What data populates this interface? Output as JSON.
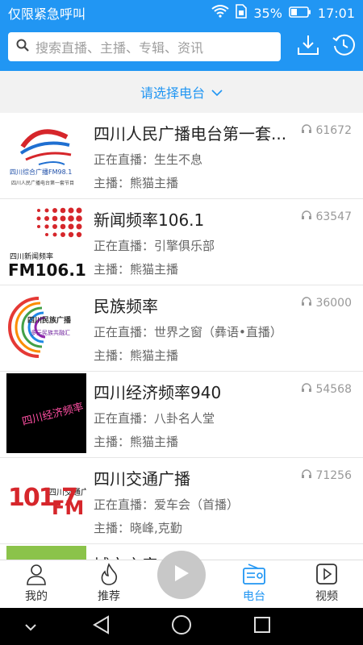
{
  "status_bar": {
    "carrier": "仅限紧急呼叫",
    "battery": "35%",
    "time": "17:01"
  },
  "search": {
    "placeholder": "搜索直播、主播、专辑、资讯"
  },
  "selector": {
    "label": "请选择电台"
  },
  "stations": [
    {
      "name": "四川人民广播电台第一套...",
      "live": "正在直播：生生不息",
      "host": "主播：熊猫主播",
      "listeners": "61672"
    },
    {
      "name": "新闻频率106.1",
      "live": "正在直播：引擎俱乐部",
      "host": "主播：熊猫主播",
      "listeners": "63547"
    },
    {
      "name": "民族频率",
      "live": "正在直播：世界之窗（彝语•直播）",
      "host": "主播：熊猫主播",
      "listeners": "36000"
    },
    {
      "name": "四川经济频率940",
      "live": "正在直播：八卦名人堂",
      "host": "主播：熊猫主播",
      "listeners": "54568"
    },
    {
      "name": "四川交通广播",
      "live": "正在直播：爱车会（首播）",
      "host": "主播：晓峰,克勤",
      "listeners": "71256"
    },
    {
      "name": "城市之音",
      "live": "",
      "host": "",
      "listeners": ""
    }
  ],
  "logos": {
    "logo1_text": "四川综合广播FM98.1",
    "logo1_sub": "四川人民广播电台第一套节目",
    "logo2_top": "四川新闻频率",
    "logo2_main": "FM106.1",
    "logo3_main": "四川民族广播",
    "logo3_sub": "多元民族共融汇",
    "logo4_text": "四川经济频率",
    "logo5_main": "四川交通广播",
    "logo5_big": "101.7",
    "logo5_fm": "FM"
  },
  "tabs": [
    {
      "label": "我的"
    },
    {
      "label": "推荐"
    },
    {
      "label": "电台"
    },
    {
      "label": "视频"
    }
  ],
  "colors": {
    "accent": "#2196f3",
    "active_tab": "#2196f3"
  }
}
